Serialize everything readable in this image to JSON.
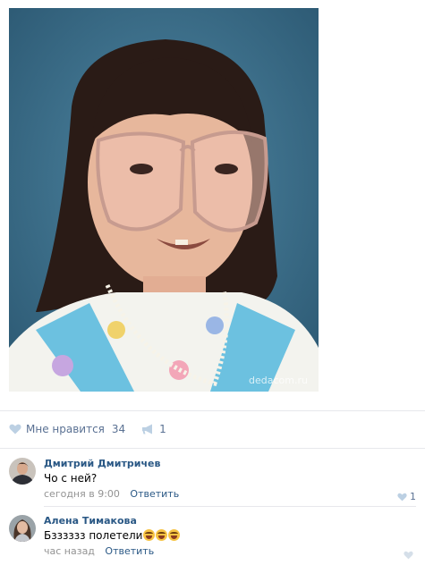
{
  "post": {
    "watermark": "dedacom.ru"
  },
  "actions": {
    "like_label": "Мне нравится",
    "like_count": "34",
    "share_count": "1",
    "like_icon": "heart-icon",
    "share_icon": "megaphone-icon"
  },
  "comments": [
    {
      "author": "Дмитрий Дмитричев",
      "text": "Чо с ней?",
      "time": "сегодня в 9:00",
      "reply_label": "Ответить",
      "likes": "1"
    },
    {
      "author": "Алена Тимакова",
      "text": "Бзззззз полетели",
      "emoji_count": 3,
      "emoji": "laughing-crying-emoji",
      "time": "час назад",
      "reply_label": "Ответить",
      "likes": ""
    }
  ],
  "colors": {
    "link": "#2a5885",
    "action": "#5a7193",
    "meta": "#939393",
    "divider": "#e7e8ec"
  }
}
